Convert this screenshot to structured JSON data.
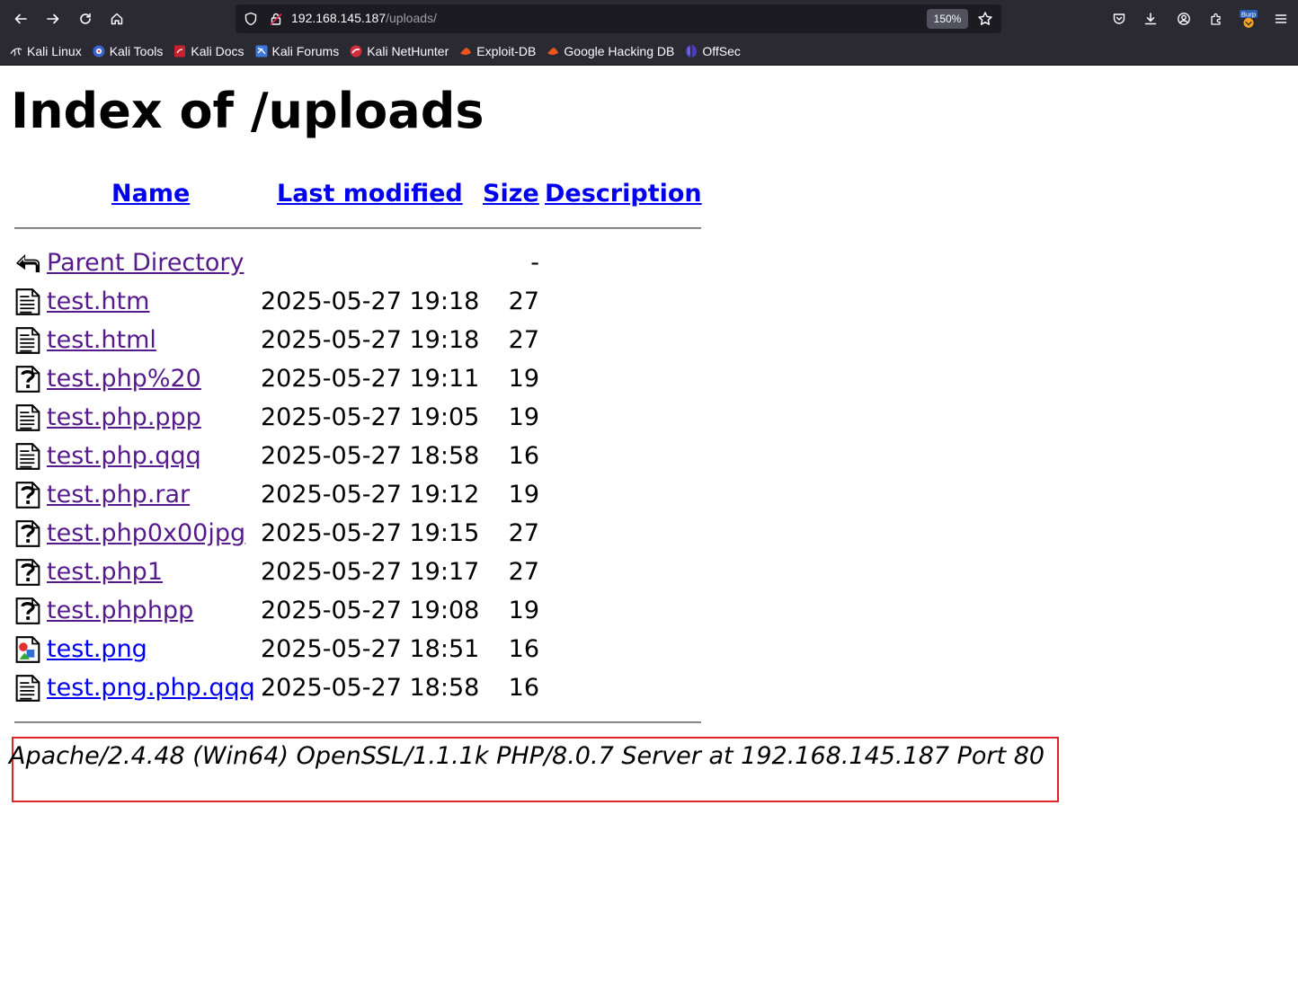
{
  "browser": {
    "url_host": "192.168.145.187",
    "url_path": "/uploads/",
    "zoom": "150%",
    "bookmarks": [
      {
        "label": "Kali Linux",
        "icon": "kali-dragon-icon"
      },
      {
        "label": "Kali Tools",
        "icon": "kali-tools-icon"
      },
      {
        "label": "Kali Docs",
        "icon": "kali-docs-icon"
      },
      {
        "label": "Kali Forums",
        "icon": "kali-forums-icon"
      },
      {
        "label": "Kali NetHunter",
        "icon": "kali-nethunter-icon"
      },
      {
        "label": "Exploit-DB",
        "icon": "exploit-db-icon"
      },
      {
        "label": "Google Hacking DB",
        "icon": "ghdb-icon"
      },
      {
        "label": "OffSec",
        "icon": "offsec-icon"
      }
    ],
    "toolbar_icons": [
      "back-icon",
      "forward-icon",
      "reload-icon",
      "home-icon",
      "shield-icon",
      "lock-icon",
      "bookmark-star-icon",
      "pocket-icon",
      "download-icon",
      "account-icon",
      "extensions-icon",
      "burp-icon",
      "menu-icon"
    ],
    "burp_badge": "Burp"
  },
  "page": {
    "title": "Index of /uploads",
    "columns": {
      "name": "Name",
      "last_modified": "Last modified",
      "size": "Size",
      "description": "Description"
    },
    "parent": {
      "label": "Parent Directory",
      "size": "-"
    },
    "files": [
      {
        "name": "test.htm",
        "modified": "2025-05-27 19:18",
        "size": "27",
        "icon": "text-file-icon",
        "visited": true
      },
      {
        "name": "test.html",
        "modified": "2025-05-27 19:18",
        "size": "27",
        "icon": "text-file-icon",
        "visited": true
      },
      {
        "name": "test.php%20",
        "modified": "2025-05-27 19:11",
        "size": "19",
        "icon": "unknown-file-icon",
        "visited": true
      },
      {
        "name": "test.php.ppp",
        "modified": "2025-05-27 19:05",
        "size": "19",
        "icon": "text-file-icon",
        "visited": true
      },
      {
        "name": "test.php.qqq",
        "modified": "2025-05-27 18:58",
        "size": "16",
        "icon": "text-file-icon",
        "visited": true
      },
      {
        "name": "test.php.rar",
        "modified": "2025-05-27 19:12",
        "size": "19",
        "icon": "unknown-file-icon",
        "visited": true
      },
      {
        "name": "test.php0x00jpg",
        "modified": "2025-05-27 19:15",
        "size": "27",
        "icon": "unknown-file-icon",
        "visited": true
      },
      {
        "name": "test.php1",
        "modified": "2025-05-27 19:17",
        "size": "27",
        "icon": "unknown-file-icon",
        "visited": true
      },
      {
        "name": "test.phphpp",
        "modified": "2025-05-27 19:08",
        "size": "19",
        "icon": "unknown-file-icon",
        "visited": true
      },
      {
        "name": "test.png",
        "modified": "2025-05-27 18:51",
        "size": "16",
        "icon": "image-file-icon",
        "visited": false
      },
      {
        "name": "test.png.php.qqq",
        "modified": "2025-05-27 18:58",
        "size": "16",
        "icon": "text-file-icon",
        "visited": false
      }
    ],
    "server_signature": "Apache/2.4.48 (Win64) OpenSSL/1.1.1k PHP/8.0.7 Server at 192.168.145.187 Port 80",
    "highlight_color": "#e0242b"
  }
}
